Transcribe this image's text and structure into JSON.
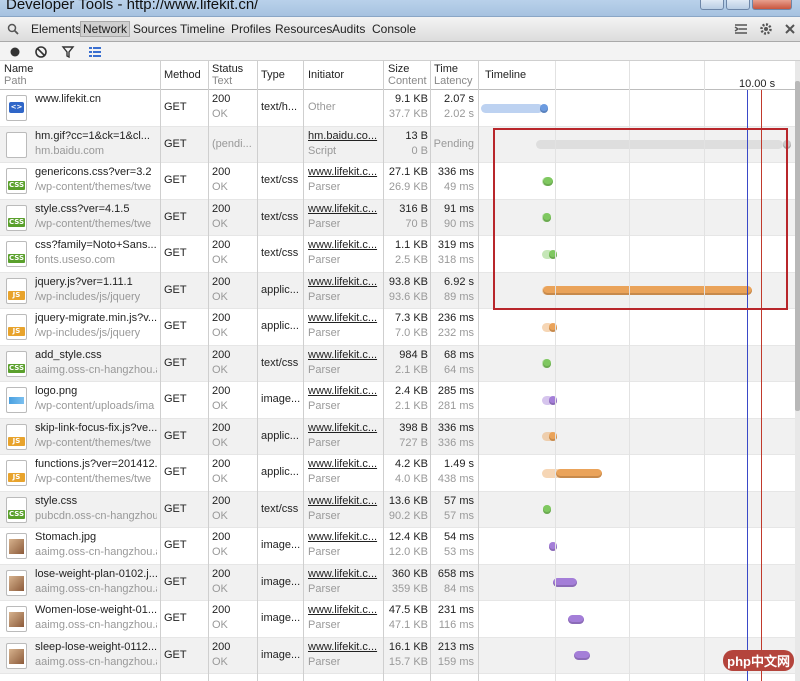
{
  "window": {
    "title": "Developer Tools - http://www.lifekit.cn/"
  },
  "toolbar": {
    "tabs": [
      {
        "label": "Elements"
      },
      {
        "label": "Network"
      },
      {
        "label": "Sources"
      },
      {
        "label": "Timeline"
      },
      {
        "label": "Profiles"
      },
      {
        "label": "Resources"
      },
      {
        "label": "Audits"
      },
      {
        "label": "Console"
      }
    ],
    "active_tab": "Network"
  },
  "columns": {
    "name": "Name",
    "path": "Path",
    "method": "Method",
    "status": "Status",
    "status_text": "Text",
    "type": "Type",
    "initiator": "Initiator",
    "size": "Size",
    "size_content": "Content",
    "time": "Time",
    "time_latency": "Latency",
    "timeline": "Timeline",
    "timeline_marker": "10.00 s"
  },
  "colors": {
    "html_bar": "#6c9be0",
    "css_bar": "#7fc860",
    "js_bar": "#eaa35a",
    "img_bar": "#a47ed8",
    "pending_bar": "#c8c8c8",
    "dom_line": "#3a49c8",
    "load_line": "#c0392b",
    "highlight": "#b8262b"
  },
  "requests": [
    {
      "name": "www.lifekit.cn",
      "path": "",
      "icon": "html",
      "method": "GET",
      "status": "200",
      "status_text": "OK",
      "type": "text/h...",
      "initiator": "Other",
      "initiator_sub": "",
      "size": "9.1 KB",
      "content": "37.7 KB",
      "time": "2.07 s",
      "latency": "2.02 s",
      "bar_type": "html",
      "bar_start": 0.0,
      "bar_recv": 0.19,
      "bar_end": 0.2
    },
    {
      "name": "hm.gif?cc=1&ck=1&cl...",
      "path": "hm.baidu.com",
      "icon": "blank",
      "method": "GET",
      "status": "(pendi...",
      "status_text": "",
      "type": "",
      "initiator": "hm.baidu.co...",
      "initiator_sub": "Script",
      "size": "13 B",
      "content": "0 B",
      "time": "Pending",
      "latency": "",
      "bar_type": "pending",
      "bar_start": 0.178,
      "bar_recv": 0.97,
      "bar_end": 0.97
    },
    {
      "name": "genericons.css?ver=3.2",
      "path": "/wp-content/themes/twe",
      "icon": "css",
      "method": "GET",
      "status": "200",
      "status_text": "OK",
      "type": "text/css",
      "initiator": "www.lifekit.c...",
      "initiator_sub": "Parser",
      "size": "27.1 KB",
      "content": "26.9 KB",
      "time": "336 ms",
      "latency": "49 ms",
      "bar_type": "css",
      "bar_start": 0.197,
      "bar_recv": 0.2,
      "bar_end": 0.23
    },
    {
      "name": "style.css?ver=4.1.5",
      "path": "/wp-content/themes/twe",
      "icon": "css",
      "method": "GET",
      "status": "200",
      "status_text": "OK",
      "type": "text/css",
      "initiator": "www.lifekit.c...",
      "initiator_sub": "Parser",
      "size": "316 B",
      "content": "70 B",
      "time": "91 ms",
      "latency": "90 ms",
      "bar_type": "css",
      "bar_start": 0.197,
      "bar_recv": 0.2,
      "bar_end": 0.213
    },
    {
      "name": "css?family=Noto+Sans...",
      "path": "fonts.useso.com",
      "icon": "css",
      "method": "GET",
      "status": "200",
      "status_text": "OK",
      "type": "text/css",
      "initiator": "www.lifekit.c...",
      "initiator_sub": "Parser",
      "size": "1.1 KB",
      "content": "2.5 KB",
      "time": "319 ms",
      "latency": "318 ms",
      "bar_type": "css",
      "bar_start": 0.197,
      "bar_recv": 0.22,
      "bar_end": 0.23
    },
    {
      "name": "jquery.js?ver=1.11.1",
      "path": "/wp-includes/js/jquery",
      "icon": "js",
      "method": "GET",
      "status": "200",
      "status_text": "OK",
      "type": "applic...",
      "initiator": "www.lifekit.c...",
      "initiator_sub": "Parser",
      "size": "93.8 KB",
      "content": "93.6 KB",
      "time": "6.92 s",
      "latency": "89 ms",
      "bar_type": "js",
      "bar_start": 0.197,
      "bar_recv": 0.2,
      "bar_end": 0.87
    },
    {
      "name": "jquery-migrate.min.js?v...",
      "path": "/wp-includes/js/jquery",
      "icon": "js",
      "method": "GET",
      "status": "200",
      "status_text": "OK",
      "type": "applic...",
      "initiator": "www.lifekit.c...",
      "initiator_sub": "Parser",
      "size": "7.3 KB",
      "content": "7.0 KB",
      "time": "236 ms",
      "latency": "232 ms",
      "bar_type": "js",
      "bar_start": 0.197,
      "bar_recv": 0.22,
      "bar_end": 0.23
    },
    {
      "name": "add_style.css",
      "path": "aaimg.oss-cn-hangzhou.a",
      "icon": "css",
      "method": "GET",
      "status": "200",
      "status_text": "OK",
      "type": "text/css",
      "initiator": "www.lifekit.c...",
      "initiator_sub": "Parser",
      "size": "984 B",
      "content": "2.1 KB",
      "time": "68 ms",
      "latency": "64 ms",
      "bar_type": "css",
      "bar_start": 0.197,
      "bar_recv": 0.2,
      "bar_end": 0.211
    },
    {
      "name": "logo.png",
      "path": "/wp-content/uploads/ima",
      "icon": "logo",
      "method": "GET",
      "status": "200",
      "status_text": "OK",
      "type": "image...",
      "initiator": "www.lifekit.c...",
      "initiator_sub": "Parser",
      "size": "2.4 KB",
      "content": "2.1 KB",
      "time": "285 ms",
      "latency": "281 ms",
      "bar_type": "img",
      "bar_start": 0.197,
      "bar_recv": 0.22,
      "bar_end": 0.23
    },
    {
      "name": "skip-link-focus-fix.js?ve...",
      "path": "/wp-content/themes/twe",
      "icon": "js",
      "method": "GET",
      "status": "200",
      "status_text": "OK",
      "type": "applic...",
      "initiator": "www.lifekit.c...",
      "initiator_sub": "Parser",
      "size": "398 B",
      "content": "727 B",
      "time": "336 ms",
      "latency": "336 ms",
      "bar_type": "js",
      "bar_start": 0.197,
      "bar_recv": 0.22,
      "bar_end": 0.24
    },
    {
      "name": "functions.js?ver=201412...",
      "path": "/wp-content/themes/twe",
      "icon": "js",
      "method": "GET",
      "status": "200",
      "status_text": "OK",
      "type": "applic...",
      "initiator": "www.lifekit.c...",
      "initiator_sub": "Parser",
      "size": "4.2 KB",
      "content": "4.0 KB",
      "time": "1.49 s",
      "latency": "438 ms",
      "bar_type": "js",
      "bar_start": 0.197,
      "bar_recv": 0.24,
      "bar_end": 0.39
    },
    {
      "name": "style.css",
      "path": "pubcdn.oss-cn-hangzhou",
      "icon": "css",
      "method": "GET",
      "status": "200",
      "status_text": "OK",
      "type": "text/css",
      "initiator": "www.lifekit.c...",
      "initiator_sub": "Parser",
      "size": "13.6 KB",
      "content": "90.2 KB",
      "time": "57 ms",
      "latency": "57 ms",
      "bar_type": "css",
      "bar_start": 0.2,
      "bar_recv": 0.2,
      "bar_end": 0.22
    },
    {
      "name": "Stomach.jpg",
      "path": "aaimg.oss-cn-hangzhou.a",
      "icon": "img",
      "method": "GET",
      "status": "200",
      "status_text": "OK",
      "type": "image...",
      "initiator": "www.lifekit.c...",
      "initiator_sub": "Parser",
      "size": "12.4 KB",
      "content": "12.0 KB",
      "time": "54 ms",
      "latency": "53 ms",
      "bar_type": "img",
      "bar_start": 0.22,
      "bar_recv": 0.22,
      "bar_end": 0.24
    },
    {
      "name": "lose-weight-plan-0102.j...",
      "path": "aaimg.oss-cn-hangzhou.a",
      "icon": "img",
      "method": "GET",
      "status": "200",
      "status_text": "OK",
      "type": "image...",
      "initiator": "www.lifekit.c...",
      "initiator_sub": "Parser",
      "size": "360 KB",
      "content": "359 KB",
      "time": "658 ms",
      "latency": "84 ms",
      "bar_type": "img",
      "bar_start": 0.23,
      "bar_recv": 0.23,
      "bar_end": 0.31
    },
    {
      "name": "Women-lose-weight-01...",
      "path": "aaimg.oss-cn-hangzhou.a",
      "icon": "img",
      "method": "GET",
      "status": "200",
      "status_text": "OK",
      "type": "image...",
      "initiator": "www.lifekit.c...",
      "initiator_sub": "Parser",
      "size": "47.5 KB",
      "content": "47.1 KB",
      "time": "231 ms",
      "latency": "116 ms",
      "bar_type": "img",
      "bar_start": 0.28,
      "bar_recv": 0.28,
      "bar_end": 0.33
    },
    {
      "name": "sleep-lose-weight-0112...",
      "path": "aaimg.oss-cn-hangzhou.a",
      "icon": "img",
      "method": "GET",
      "status": "200",
      "status_text": "OK",
      "type": "image...",
      "initiator": "www.lifekit.c...",
      "initiator_sub": "Parser",
      "size": "16.1 KB",
      "content": "15.7 KB",
      "time": "213 ms",
      "latency": "159 ms",
      "bar_type": "img",
      "bar_start": 0.3,
      "bar_recv": 0.3,
      "bar_end": 0.35
    }
  ],
  "timeline": {
    "dom_line_at": 0.855,
    "load_line_at": 0.9
  },
  "watermark": "php中文网"
}
